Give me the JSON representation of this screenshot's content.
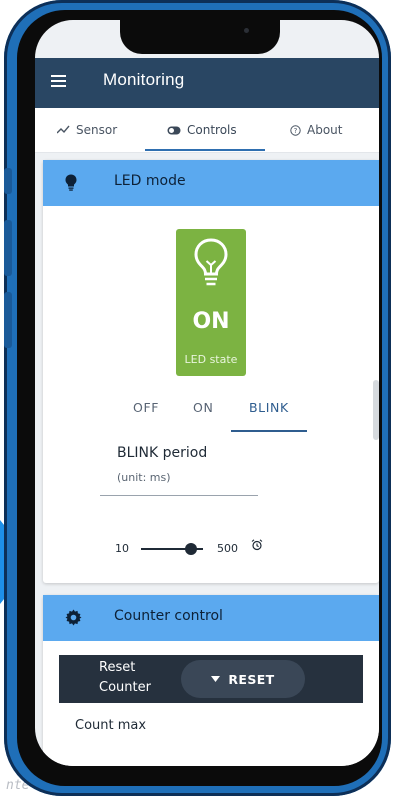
{
  "app": {
    "title": "Monitoring"
  },
  "tabs": [
    {
      "label": "Sensor",
      "icon": "trend-line-icon"
    },
    {
      "label": "Controls",
      "icon": "toggle-icon"
    },
    {
      "label": "About",
      "icon": "help-circle-icon"
    }
  ],
  "led_card": {
    "title": "LED mode",
    "header_icon": "bulb-icon",
    "led_value": "ON",
    "led_caption": "LED state",
    "modes": [
      "OFF",
      "ON",
      "BLINK"
    ],
    "selected_mode": "BLINK",
    "blink_label": "BLINK period",
    "blink_unit": "(unit: ms)",
    "slider_min": "10",
    "slider_max": "500",
    "slider_level": 0.73
  },
  "counter_card": {
    "title": "Counter control",
    "header_icon": "gear-icon",
    "reset_label_line1": "Reset",
    "reset_label_line2": "Counter",
    "reset_button": "RESET",
    "count_max_label": "Count max"
  },
  "background_text": "nte",
  "colors": {
    "appbar": "#294663",
    "card_header": "#5ba9ef",
    "led_on": "#7cb342",
    "phone_frame": "#1f6fb8",
    "counter_bar": "#26313e"
  }
}
